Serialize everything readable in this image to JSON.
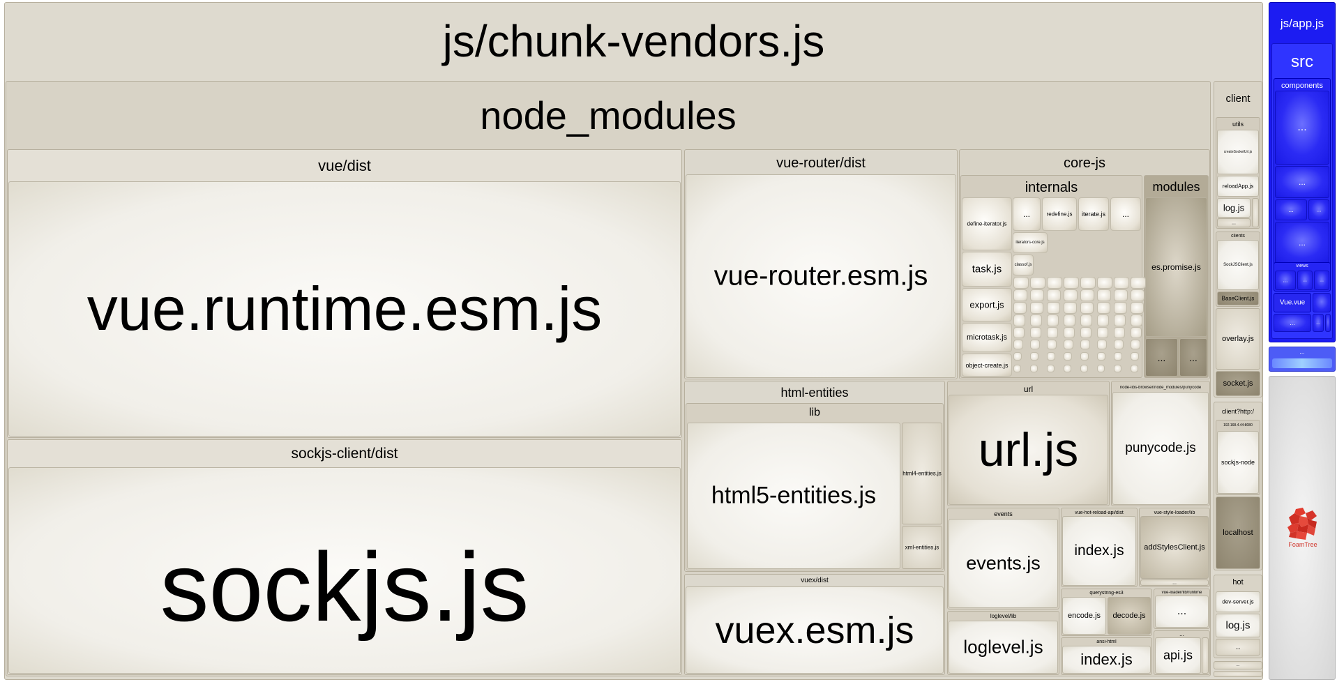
{
  "sidebar_toggle": "›",
  "chunk": {
    "title": "js/chunk-vendors.js"
  },
  "node_modules": "node_modules",
  "vue": {
    "dir": "vue/dist",
    "file": "vue.runtime.esm.js"
  },
  "sockjs": {
    "dir": "sockjs-client/dist",
    "file": "sockjs.js"
  },
  "vue_router": {
    "dir": "vue-router/dist",
    "file": "vue-router.esm.js"
  },
  "core_js": {
    "dir": "core-js",
    "internals": "internals",
    "modules": "modules",
    "files": [
      "define-iterator.js",
      "redefine.js",
      "iterate.js",
      "iterators-core.js",
      "task.js",
      "classof.js",
      "export.js",
      "microtask.js",
      "object-create.js"
    ],
    "es_promise": "es.promise.js",
    "more": "..."
  },
  "html_entities": {
    "dir": "html-entities",
    "lib": "lib",
    "html5": "html5-entities.js",
    "html4": "html4-entities.js",
    "xml": "xml-entities.js"
  },
  "url": {
    "dir": "url",
    "file": "url.js"
  },
  "punycode": {
    "dir": "node-libs-browser/node_modules/punycode",
    "file": "punycode.js"
  },
  "events": {
    "dir": "events",
    "file": "events.js"
  },
  "hot_reload": {
    "dir": "vue-hot-reload-api/dist",
    "file": "index.js"
  },
  "style_loader": {
    "dir": "vue-style-loader/lib",
    "file": "addStylesClient.js"
  },
  "vuex": {
    "dir": "vuex/dist",
    "file": "vuex.esm.js"
  },
  "querystring": {
    "dir": "querystring-es3",
    "encode": "encode.js",
    "decode": "decode.js"
  },
  "vue_loader": {
    "dir": "vue-loader/lib/runtime"
  },
  "loglevel": {
    "dir": "loglevel/lib",
    "file": "loglevel.js"
  },
  "ansi_html": {
    "dir": "ansi-html",
    "file": "index.js"
  },
  "api": {
    "file": "api.js"
  },
  "client": {
    "title": "client",
    "utils": "utils",
    "create_socket_url": "createSocketUrl.js",
    "reload_app": "reloadApp.js",
    "log": "log.js",
    "clients": "clients",
    "sockjs_client": "SockJSClient.js",
    "base_client": "BaseClient.js",
    "overlay": "overlay.js",
    "socket": "socket.js"
  },
  "client_http": {
    "title": "client?http:/",
    "host": "192.168.4.44:8080",
    "sockjs_node": "sockjs-node",
    "localhost": "localhost"
  },
  "hot": {
    "title": "hot",
    "dev_server": "dev-server.js",
    "log": "log.js"
  },
  "app": {
    "title": "js/app.js",
    "src": "src",
    "components": "components",
    "views": "views",
    "app_vue": "Vue.vue"
  },
  "ellipsis": "...",
  "logo": "FoamTree",
  "colors": {
    "vendor_bg": "#dcd8cd",
    "app_blue": "#1f1ff0",
    "sidebar_grey": "#d9d9d9"
  }
}
